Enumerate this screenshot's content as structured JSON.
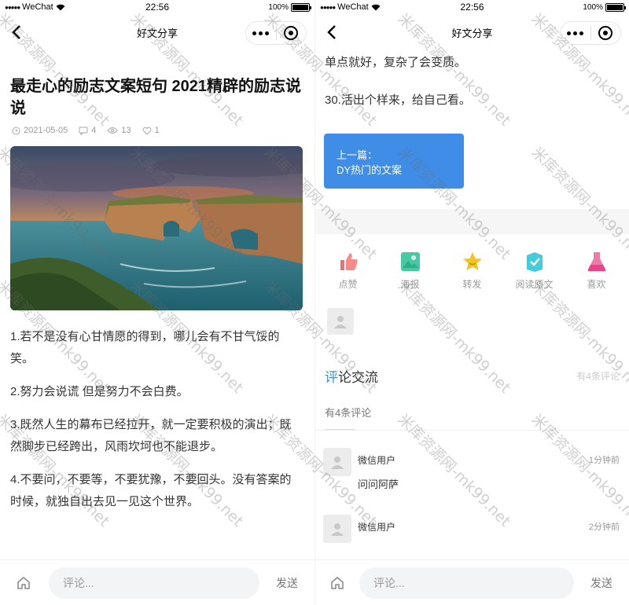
{
  "status_bar": {
    "carrier": "WeChat",
    "time": "22:56",
    "battery": "100%",
    "battery_level": 1.0
  },
  "nav": {
    "title": "好文分享"
  },
  "article": {
    "title": "最走心的励志文案短句 2021精辟的励志说说",
    "date": "2021-05-05",
    "comments": "4",
    "views": "13",
    "likes": "1",
    "paragraphs": [
      "1.若不是没有心甘情愿的得到，哪儿会有不甘气馁的笑。",
      "2.努力会说谎 但是努力不会白费。",
      "3.既然人生的幕布已经拉开，就一定要积极的演出；既然脚步已经跨出，风雨坎坷也不能退步。",
      "4.不要问，不要等，不要犹豫，不要回头。没有答案的时候，就独自出去见一见这个世界。"
    ]
  },
  "bottom_bar": {
    "placeholder": "评论...",
    "send": "发送"
  },
  "right": {
    "paragraphs": [
      "单点就好，复杂了会变质。",
      "30.活出个样来，给自己看。"
    ],
    "prev": {
      "label": "上一篇：",
      "title": "DY热门的文案"
    },
    "actions": [
      {
        "label": "点赞",
        "icon": "thumbs-up-icon",
        "color": "#f26d6d"
      },
      {
        "label": "海报",
        "icon": "poster-image-icon",
        "color": "#3fc7a0"
      },
      {
        "label": "转发",
        "icon": "star-share-icon",
        "color": "#f7c21c"
      },
      {
        "label": "阅读原文",
        "icon": "read-original-icon",
        "color": "#35c6d6"
      },
      {
        "label": "喜欢",
        "icon": "flask-like-icon",
        "color": "#f0609e"
      }
    ],
    "comments_title_accent": "评",
    "comments_title_rest": "论交流",
    "comments_count": "有4条评论",
    "tab_label": "有4条评论",
    "comments": [
      {
        "user": "微信用户",
        "time": "1分钟前",
        "text": "问问阿萨"
      },
      {
        "user": "微信用户",
        "time": "2分钟前",
        "text": ""
      }
    ]
  },
  "watermark": "米库资源网-mk99.net",
  "colors": {
    "accent": "#3f8de6",
    "meta": "#999999",
    "input_bg": "#f3f4f6"
  }
}
